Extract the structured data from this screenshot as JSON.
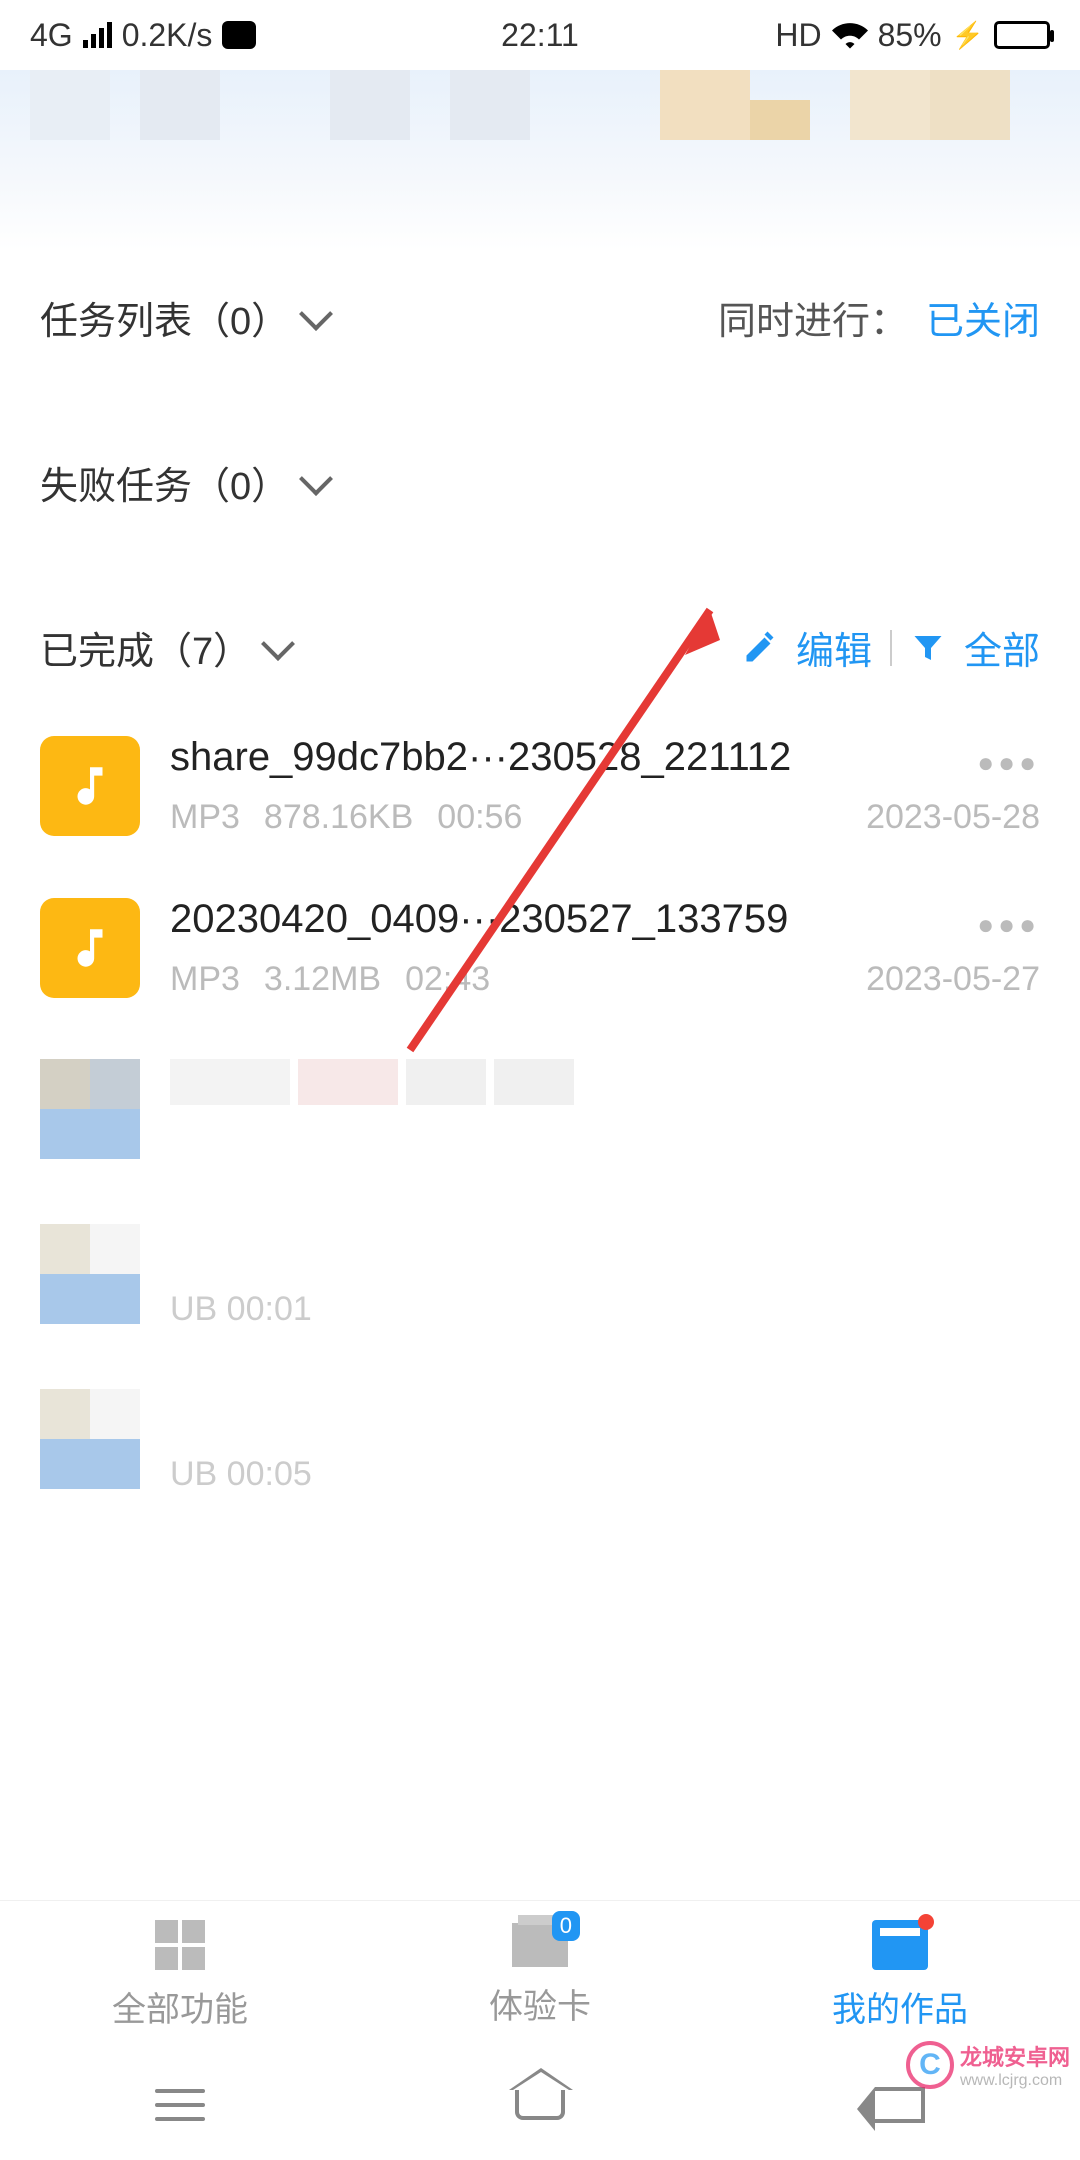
{
  "status": {
    "network": "4G",
    "speed": "0.2K/s",
    "time": "22:11",
    "hd": "HD",
    "battery": "85%"
  },
  "sections": {
    "tasks_label": "任务列表（0）",
    "concurrent_label": "同时进行：",
    "concurrent_value": "已关闭",
    "failed_label": "失败任务（0）",
    "done_label": "已完成（7）",
    "edit_label": "编辑",
    "filter_label": "全部"
  },
  "files": [
    {
      "name": "share_99dc7bb2···230528_221112",
      "type": "MP3",
      "size": "878.16KB",
      "duration": "00:56",
      "date": "2023-05-28"
    },
    {
      "name": "20230420_0409···230527_133759",
      "type": "MP3",
      "size": "3.12MB",
      "duration": "02:43",
      "date": "2023-05-27"
    }
  ],
  "blurred_meta": {
    "item2": "UB   00:01",
    "item3": "UB   00:05"
  },
  "tabs": {
    "all": "全部功能",
    "card": "体验卡",
    "card_badge": "0",
    "works": "我的作品"
  },
  "watermark": {
    "logo_letter": "C",
    "line1": "龙城安卓网",
    "line2": "www.lcjrg.com"
  }
}
